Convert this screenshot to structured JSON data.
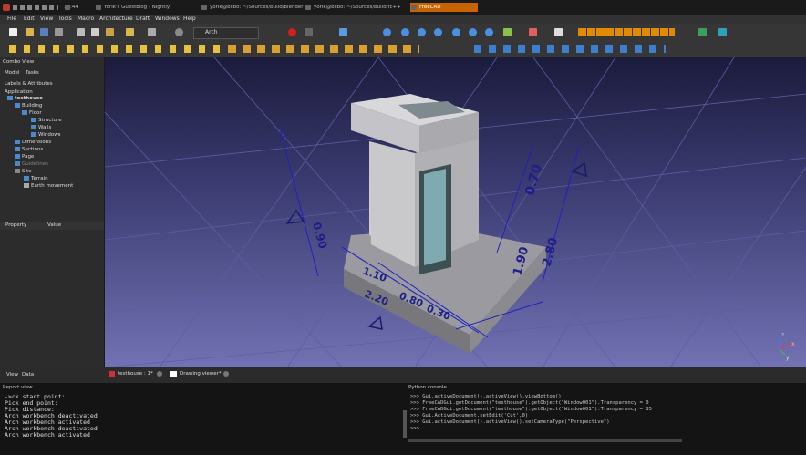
{
  "taskbar": {
    "clock": "11:44",
    "tasks": [
      "Yorik's Guestblog - Nightly",
      "yorik@bilbo: ~/Sources/build/blender",
      "yorik@bilbo: ~/Sources/build/fc++",
      "FreeCAD"
    ]
  },
  "menu": [
    "File",
    "Edit",
    "View",
    "Tools",
    "Macro",
    "Architecture",
    "Draft",
    "Windows",
    "Help"
  ],
  "toolbar": {
    "workbench": "Arch"
  },
  "combo": {
    "title": "Combo View",
    "tabs": [
      "Model",
      "Tasks"
    ],
    "section": "Labels & Attributes",
    "app": "Application",
    "tree": [
      {
        "label": "testhouse",
        "level": 0
      },
      {
        "label": "Building",
        "level": 1
      },
      {
        "label": "Floor",
        "level": 2
      },
      {
        "label": "Structure",
        "level": 3
      },
      {
        "label": "Walls",
        "level": 3
      },
      {
        "label": "Windows",
        "level": 3
      },
      {
        "label": "Dimensions",
        "level": 1
      },
      {
        "label": "Sections",
        "level": 1
      },
      {
        "label": "Page",
        "level": 1
      },
      {
        "label": "Guidelines",
        "level": 1
      },
      {
        "label": "Site",
        "level": 1
      },
      {
        "label": "Terrain",
        "level": 2
      },
      {
        "label": "Earth movement",
        "level": 2
      }
    ],
    "prop_header": [
      "Property",
      "Value"
    ],
    "bottom_tabs": [
      "View",
      "Data"
    ]
  },
  "viewport": {
    "dimensions": [
      "1.10",
      "2.20",
      "0.80",
      "0.30",
      "1.90",
      "2.80",
      "0.70",
      "0.90"
    ],
    "axis": [
      "x",
      "y",
      "z"
    ]
  },
  "doctabs": [
    "testhouse : 1*",
    "Drawing viewer*"
  ],
  "report": {
    "title": "Report view",
    "lines": [
      "->ck start point:",
      "Pick end point:",
      "Pick distance:",
      "Arch workbench deactivated",
      "Arch workbench activated",
      "Arch workbench deactivated",
      "Arch workbench activated"
    ]
  },
  "python": {
    "title": "Python console",
    "lines": [
      ">>> Gui.activeDocument().activeView().viewBottom()",
      ">>> FreeCADGui.getDocument(\"testhouse\").getObject(\"Window001\").Transparency = 0",
      ">>> FreeCADGui.getDocument(\"testhouse\").getObject(\"Window001\").Transparency = 85",
      ">>> Gui.ActiveDocument.setEdit('Cut',0)",
      ">>> Gui.activeDocument().activeView().setCameraType(\"Perspective\")",
      ">>> "
    ]
  },
  "colors": {
    "accent": "#c86400",
    "viewport_top": "#1b1b3c",
    "viewport_bottom": "#7272b4",
    "dimension": "#2020c0"
  }
}
